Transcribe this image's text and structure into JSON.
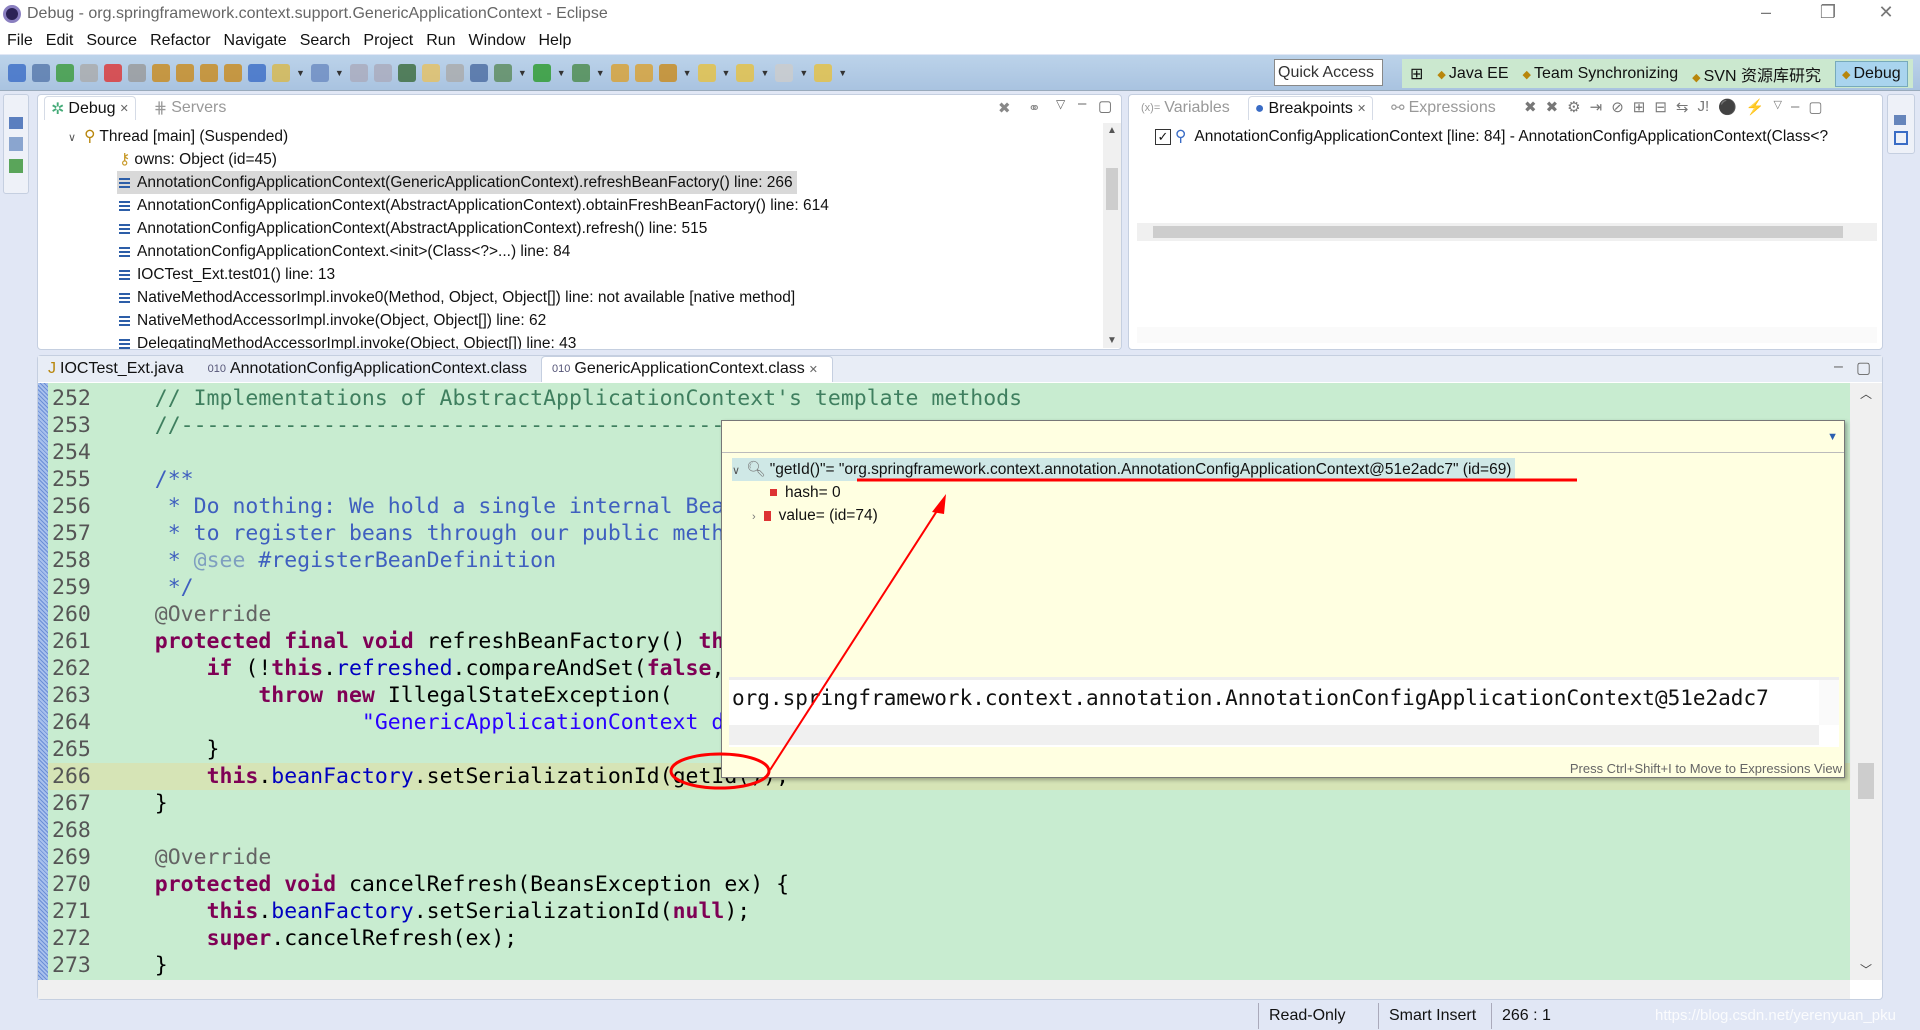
{
  "window": {
    "title": "Debug - org.springframework.context.support.GenericApplicationContext - Eclipse"
  },
  "menu": [
    "File",
    "Edit",
    "Source",
    "Refactor",
    "Navigate",
    "Search",
    "Project",
    "Run",
    "Window",
    "Help"
  ],
  "toolbar": {
    "icons": [
      "display-icon",
      "skip-breakpoints-icon",
      "resume-icon",
      "suspend-icon",
      "terminate-icon",
      "disconnect-icon",
      "step-into-icon",
      "step-over-icon",
      "step-return-icon",
      "drop-to-frame-icon",
      "use-step-filters-icon",
      "new-java-project-icon",
      "new-class-icon",
      "save-icon",
      "save-all-icon",
      "open-type-icon",
      "toggle-mark-occurrences-icon",
      "toggle-breadcrumb-icon",
      "show-whitespace-icon",
      "debug-run-icon",
      "run-icon",
      "run-external-tools-icon",
      "open-folder-icon",
      "open-file-icon",
      "edit-icon",
      "next-annotation-icon",
      "prev-annotation-icon",
      "back-icon",
      "forward-icon"
    ],
    "quick_access": "Quick Access"
  },
  "perspectives": [
    {
      "label": "Java EE"
    },
    {
      "label": "Team Synchronizing"
    },
    {
      "label": "SVN 资源库研究"
    },
    {
      "label": "Debug",
      "active": true
    }
  ],
  "debug_view": {
    "tabs": [
      {
        "label": "Debug",
        "active": true
      },
      {
        "label": "Servers"
      }
    ],
    "thread": "Thread [main] (Suspended)",
    "owns": "owns: Object  (id=45)",
    "frames": [
      "AnnotationConfigApplicationContext(GenericApplicationContext).refreshBeanFactory() line: 266",
      "AnnotationConfigApplicationContext(AbstractApplicationContext).obtainFreshBeanFactory() line: 614",
      "AnnotationConfigApplicationContext(AbstractApplicationContext).refresh() line: 515",
      "AnnotationConfigApplicationContext.<init>(Class<?>...) line: 84",
      "IOCTest_Ext.test01() line: 13",
      "NativeMethodAccessorImpl.invoke0(Method, Object, Object[]) line: not available [native method]",
      "NativeMethodAccessorImpl.invoke(Object, Object[]) line: 62",
      "DelegatingMethodAccessorImpl.invoke(Object, Object[]) line: 43"
    ],
    "selected_frame": 0
  },
  "breakpoints_view": {
    "tabs": [
      {
        "label": "Variables"
      },
      {
        "label": "Breakpoints",
        "active": true
      },
      {
        "label": "Expressions"
      }
    ],
    "items": [
      {
        "checked": true,
        "label": "AnnotationConfigApplicationContext [line: 84] - AnnotationConfigApplicationContext(Class<?"
      }
    ]
  },
  "editor": {
    "tabs": [
      {
        "label": "IOCTest_Ext.java"
      },
      {
        "label": "AnnotationConfigApplicationContext.class"
      },
      {
        "label": "GenericApplicationContext.class",
        "active": true
      }
    ],
    "current_line": 266,
    "lines": [
      {
        "n": "252",
        "s": [
          [
            "pl",
            "    "
          ],
          [
            "cm",
            "// Implementations of AbstractApplicationContext's template methods"
          ]
        ]
      },
      {
        "n": "253",
        "s": [
          [
            "pl",
            "    "
          ],
          [
            "cm",
            "//---------------------------------------------"
          ]
        ]
      },
      {
        "n": "254",
        "s": []
      },
      {
        "n": "255",
        "s": [
          [
            "pl",
            "    "
          ],
          [
            "jd",
            "/**"
          ]
        ]
      },
      {
        "n": "256",
        "s": [
          [
            "pl",
            "     "
          ],
          [
            "jd",
            "* Do nothing: We hold a single internal Bea"
          ]
        ]
      },
      {
        "n": "257",
        "s": [
          [
            "pl",
            "     "
          ],
          [
            "jd",
            "* to register beans through our public meth"
          ]
        ]
      },
      {
        "n": "258",
        "s": [
          [
            "pl",
            "     "
          ],
          [
            "jd",
            "* "
          ],
          [
            "jt",
            "@see"
          ],
          [
            "jd",
            " #registerBeanDefinition"
          ]
        ]
      },
      {
        "n": "259",
        "s": [
          [
            "pl",
            "     "
          ],
          [
            "jd",
            "*/"
          ]
        ]
      },
      {
        "n": "260",
        "s": [
          [
            "pl",
            "    "
          ],
          [
            "an",
            "@Override"
          ]
        ]
      },
      {
        "n": "261",
        "s": [
          [
            "pl",
            "    "
          ],
          [
            "kw",
            "protected"
          ],
          [
            "pl",
            " "
          ],
          [
            "kw",
            "final"
          ],
          [
            "pl",
            " "
          ],
          [
            "kw",
            "void"
          ],
          [
            "pl",
            " refreshBeanFactory() "
          ],
          [
            "kw",
            "th"
          ]
        ]
      },
      {
        "n": "262",
        "s": [
          [
            "pl",
            "        "
          ],
          [
            "kw",
            "if"
          ],
          [
            "pl",
            " (!"
          ],
          [
            "kw",
            "this"
          ],
          [
            "pl",
            "."
          ],
          [
            "fd",
            "refreshed"
          ],
          [
            "pl",
            ".compareAndSet("
          ],
          [
            "kw",
            "false"
          ],
          [
            "pl",
            ","
          ]
        ]
      },
      {
        "n": "263",
        "s": [
          [
            "pl",
            "            "
          ],
          [
            "kw",
            "throw"
          ],
          [
            "pl",
            " "
          ],
          [
            "kw",
            "new"
          ],
          [
            "pl",
            " IllegalStateException("
          ]
        ]
      },
      {
        "n": "264",
        "s": [
          [
            "pl",
            "                    "
          ],
          [
            "st",
            "\"GenericApplicationContext d"
          ]
        ]
      },
      {
        "n": "265",
        "s": [
          [
            "pl",
            "        }"
          ]
        ]
      },
      {
        "n": "266",
        "s": [
          [
            "pl",
            "        "
          ],
          [
            "kw",
            "this"
          ],
          [
            "pl",
            "."
          ],
          [
            "fd",
            "beanFactory"
          ],
          [
            "pl",
            ".setSerializationId(getId());"
          ]
        ]
      },
      {
        "n": "267",
        "s": [
          [
            "pl",
            "    }"
          ]
        ]
      },
      {
        "n": "268",
        "s": []
      },
      {
        "n": "269",
        "s": [
          [
            "pl",
            "    "
          ],
          [
            "an",
            "@Override"
          ]
        ]
      },
      {
        "n": "270",
        "s": [
          [
            "pl",
            "    "
          ],
          [
            "kw",
            "protected"
          ],
          [
            "pl",
            " "
          ],
          [
            "kw",
            "void"
          ],
          [
            "pl",
            " cancelRefresh(BeansException ex) {"
          ]
        ]
      },
      {
        "n": "271",
        "s": [
          [
            "pl",
            "        "
          ],
          [
            "kw",
            "this"
          ],
          [
            "pl",
            "."
          ],
          [
            "fd",
            "beanFactory"
          ],
          [
            "pl",
            ".setSerializationId("
          ],
          [
            "kw",
            "null"
          ],
          [
            "pl",
            ");"
          ]
        ]
      },
      {
        "n": "272",
        "s": [
          [
            "pl",
            "        "
          ],
          [
            "kw",
            "super"
          ],
          [
            "pl",
            ".cancelRefresh(ex);"
          ]
        ]
      },
      {
        "n": "273",
        "s": [
          [
            "pl",
            "    }"
          ]
        ]
      }
    ]
  },
  "inspect_popup": {
    "expr_name": "\"getId()\"= ",
    "expr_value": "\"org.springframework.context.annotation.AnnotationConfigApplicationContext@51e2adc7\"",
    "expr_id": " (id=69)",
    "children": [
      {
        "label": "hash= 0"
      },
      {
        "label": "value= (id=74)"
      }
    ],
    "detail": "org.springframework.context.annotation.AnnotationConfigApplicationContext@51e2adc7",
    "hint": "Press Ctrl+Shift+I to Move to Expressions View"
  },
  "status": {
    "mode": "Read-Only",
    "insert": "Smart Insert",
    "position": "266 : 1"
  },
  "watermark": "https://blog.csdn.net/yerenyuan_pku",
  "colors": {
    "editor_bg": "#c8ecd0",
    "current_line": "#d6e4b6",
    "popup_bg": "#ffffe1",
    "annotation": "#ff0000"
  }
}
